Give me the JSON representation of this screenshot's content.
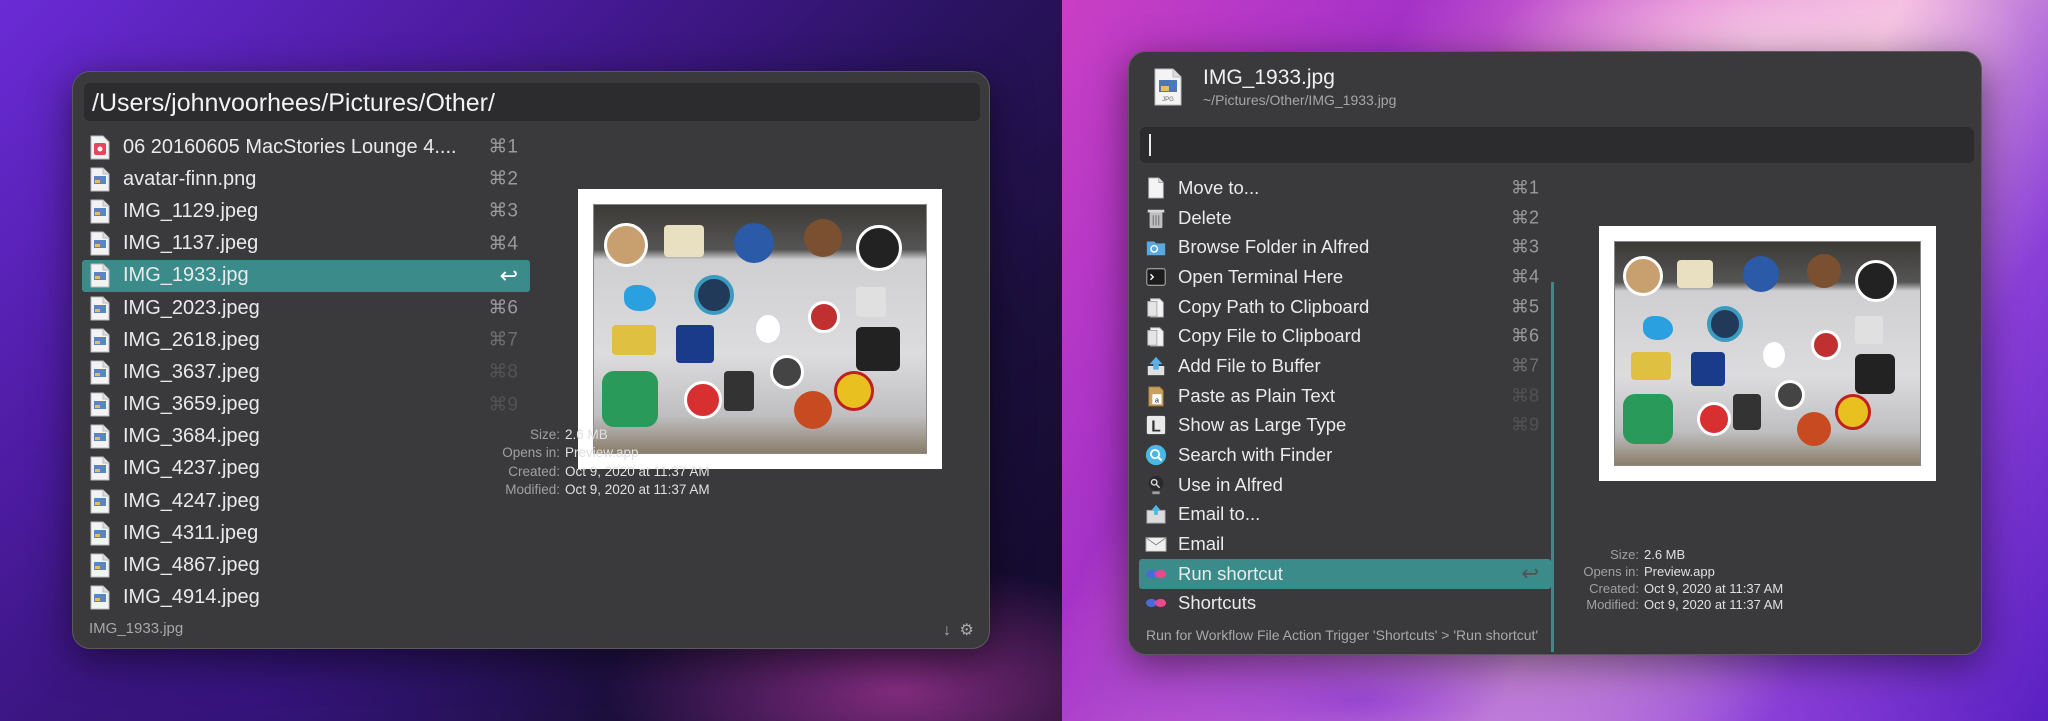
{
  "left_window": {
    "query": "/Users/johnvoorhees/Pictures/Other/",
    "results": [
      {
        "label": "06 20160605 MacStories Lounge 4....",
        "shortcut": "⌘1",
        "icon": "audio-file-icon"
      },
      {
        "label": "avatar-finn.png",
        "shortcut": "⌘2",
        "icon": "image-file-icon"
      },
      {
        "label": "IMG_1129.jpeg",
        "shortcut": "⌘3",
        "icon": "image-file-icon"
      },
      {
        "label": "IMG_1137.jpeg",
        "shortcut": "⌘4",
        "icon": "image-file-icon"
      },
      {
        "label": "IMG_1933.jpg",
        "shortcut": "↩",
        "icon": "image-file-icon",
        "selected": true
      },
      {
        "label": "IMG_2023.jpeg",
        "shortcut": "⌘6",
        "icon": "image-file-icon"
      },
      {
        "label": "IMG_2618.jpeg",
        "shortcut": "⌘7",
        "icon": "image-file-icon"
      },
      {
        "label": "IMG_3637.jpeg",
        "shortcut": "⌘8",
        "icon": "image-file-icon"
      },
      {
        "label": "IMG_3659.jpeg",
        "shortcut": "⌘9",
        "icon": "image-file-icon"
      },
      {
        "label": "IMG_3684.jpeg",
        "shortcut": "",
        "icon": "image-file-icon"
      },
      {
        "label": "IMG_4237.jpeg",
        "shortcut": "",
        "icon": "image-file-icon"
      },
      {
        "label": "IMG_4247.jpeg",
        "shortcut": "",
        "icon": "image-file-icon"
      },
      {
        "label": "IMG_4311.jpeg",
        "shortcut": "",
        "icon": "image-file-icon"
      },
      {
        "label": "IMG_4867.jpeg",
        "shortcut": "",
        "icon": "image-file-icon"
      },
      {
        "label": "IMG_4914.jpeg",
        "shortcut": "",
        "icon": "image-file-icon"
      }
    ],
    "meta": {
      "size_label": "Size:",
      "size": "2.6 MB",
      "opens_label": "Opens in:",
      "opens": "Preview.app",
      "created_label": "Created:",
      "created": "Oct 9, 2020 at 11:37 AM",
      "modified_label": "Modified:",
      "modified": "Oct 9, 2020 at 11:37 AM"
    },
    "footer": "IMG_1933.jpg"
  },
  "right_window": {
    "file_name": "IMG_1933.jpg",
    "file_path": "~/Pictures/Other/IMG_1933.jpg",
    "file_icon_label": "JPG",
    "actions": [
      {
        "label": "Move to...",
        "shortcut": "⌘1",
        "icon": "document-icon"
      },
      {
        "label": "Delete",
        "shortcut": "⌘2",
        "icon": "trash-icon"
      },
      {
        "label": "Browse Folder in Alfred",
        "shortcut": "⌘3",
        "icon": "browse-folder-icon"
      },
      {
        "label": "Open Terminal Here",
        "shortcut": "⌘4",
        "icon": "terminal-icon"
      },
      {
        "label": "Copy Path to Clipboard",
        "shortcut": "⌘5",
        "icon": "clipboard-icon"
      },
      {
        "label": "Copy File to Clipboard",
        "shortcut": "⌘6",
        "icon": "clipboard-icon"
      },
      {
        "label": "Add File to Buffer",
        "shortcut": "⌘7",
        "icon": "buffer-arrow-icon"
      },
      {
        "label": "Paste as Plain Text",
        "shortcut": "⌘8",
        "icon": "plain-text-icon"
      },
      {
        "label": "Show as Large Type",
        "shortcut": "⌘9",
        "icon": "large-type-icon"
      },
      {
        "label": "Search with Finder",
        "shortcut": "",
        "icon": "magnifier-icon"
      },
      {
        "label": "Use in Alfred",
        "shortcut": "",
        "icon": "alfred-icon"
      },
      {
        "label": "Email to...",
        "shortcut": "",
        "icon": "email-contact-icon"
      },
      {
        "label": "Email",
        "shortcut": "",
        "icon": "envelope-icon"
      },
      {
        "label": "Run shortcut",
        "shortcut": "↩",
        "icon": "shortcuts-icon",
        "selected": true
      },
      {
        "label": "Shortcuts",
        "shortcut": "",
        "icon": "shortcuts-icon"
      }
    ],
    "meta": {
      "size_label": "Size:",
      "size": "2.6 MB",
      "opens_label": "Opens in:",
      "opens": "Preview.app",
      "created_label": "Created:",
      "created": "Oct 9, 2020 at 11:37 AM",
      "modified_label": "Modified:",
      "modified": "Oct 9, 2020 at 11:37 AM"
    },
    "footer": "Run for Workflow File Action Trigger 'Shortcuts' > 'Run shortcut'"
  },
  "colors": {
    "selection": "#3b8b8b",
    "window_bg": "#3a3a3d",
    "input_bg": "#2c2c2e"
  }
}
